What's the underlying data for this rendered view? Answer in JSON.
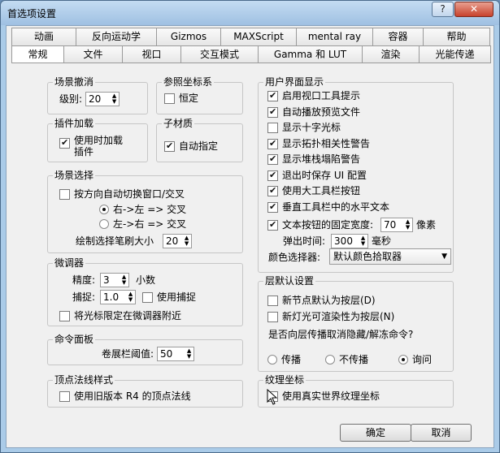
{
  "window": {
    "title": "首选项设置",
    "help_label": "?",
    "close_label": "✕"
  },
  "tabs": {
    "row1": [
      "动画",
      "反向运动学",
      "Gizmos",
      "MAXScript",
      "mental ray",
      "容器",
      "帮助"
    ],
    "row2": [
      "常规",
      "文件",
      "视口",
      "交互模式",
      "Gamma 和 LUT",
      "渲染",
      "光能传递"
    ]
  },
  "scene_undo": {
    "title": "场景撤消",
    "levels_label": "级别:",
    "levels_value": "20"
  },
  "ref_coord": {
    "title": "参照坐标系",
    "constant_label": "恒定"
  },
  "plugin_loading": {
    "title": "插件加载",
    "load_on_use_label": "使用时加载插件"
  },
  "sub_material": {
    "title": "子材质",
    "auto_assign_label": "自动指定"
  },
  "scene_selection": {
    "title": "场景选择",
    "auto_switch_label": "按方向自动切换窗口/交叉",
    "right_left_label": "右->左 => 交叉",
    "left_right_label": "左->右 => 交叉",
    "brush_size_label": "绘制选择笔刷大小",
    "brush_size_value": "20"
  },
  "spinners": {
    "title": "微调器",
    "precision_label": "精度:",
    "precision_value": "3",
    "decimals_label": "小数",
    "snap_label": "捕捉:",
    "snap_value": "1.0",
    "use_snap_label": "使用捕捉",
    "wrap_cursor_label": "将光标限定在微调器附近"
  },
  "command_panel": {
    "title": "命令面板",
    "rollup_label": "卷展栏阈值:",
    "rollup_value": "50"
  },
  "vertex_normals": {
    "title": "顶点法线样式",
    "legacy_label": "使用旧版本 R4 的顶点法线"
  },
  "ui_display": {
    "title": "用户界面显示",
    "items": [
      {
        "label": "启用视口工具提示",
        "checked": true
      },
      {
        "label": "自动播放预览文件",
        "checked": true
      },
      {
        "label": "显示十字光标",
        "checked": false
      },
      {
        "label": "显示拓扑相关性警告",
        "checked": true
      },
      {
        "label": "显示堆栈塌陷警告",
        "checked": true
      },
      {
        "label": "退出时保存 UI 配置",
        "checked": true
      },
      {
        "label": "使用大工具栏按钮",
        "checked": true
      },
      {
        "label": "垂直工具栏中的水平文本",
        "checked": true
      }
    ],
    "fixed_width_label": "文本按钮的固定宽度:",
    "fixed_width_value": "70",
    "pixels_label": "像素",
    "flyout_label": "弹出时间:",
    "flyout_value": "300",
    "ms_label": "毫秒",
    "color_picker_label": "颜色选择器:",
    "color_picker_value": "默认颜色拾取器"
  },
  "layer_defaults": {
    "title": "层默认设置",
    "new_nodes_label": "新节点默认为按层(D)",
    "new_lights_label": "新灯光可渲染性为按层(N)",
    "question_label": "是否向层传播取消隐藏/解冻命令?",
    "propagate_label": "传播",
    "no_propagate_label": "不传播",
    "ask_label": "询问"
  },
  "texture_coords": {
    "title": "纹理坐标",
    "real_world_label": "使用真实世界纹理坐标"
  },
  "footer": {
    "ok_label": "确定",
    "cancel_label": "取消"
  }
}
